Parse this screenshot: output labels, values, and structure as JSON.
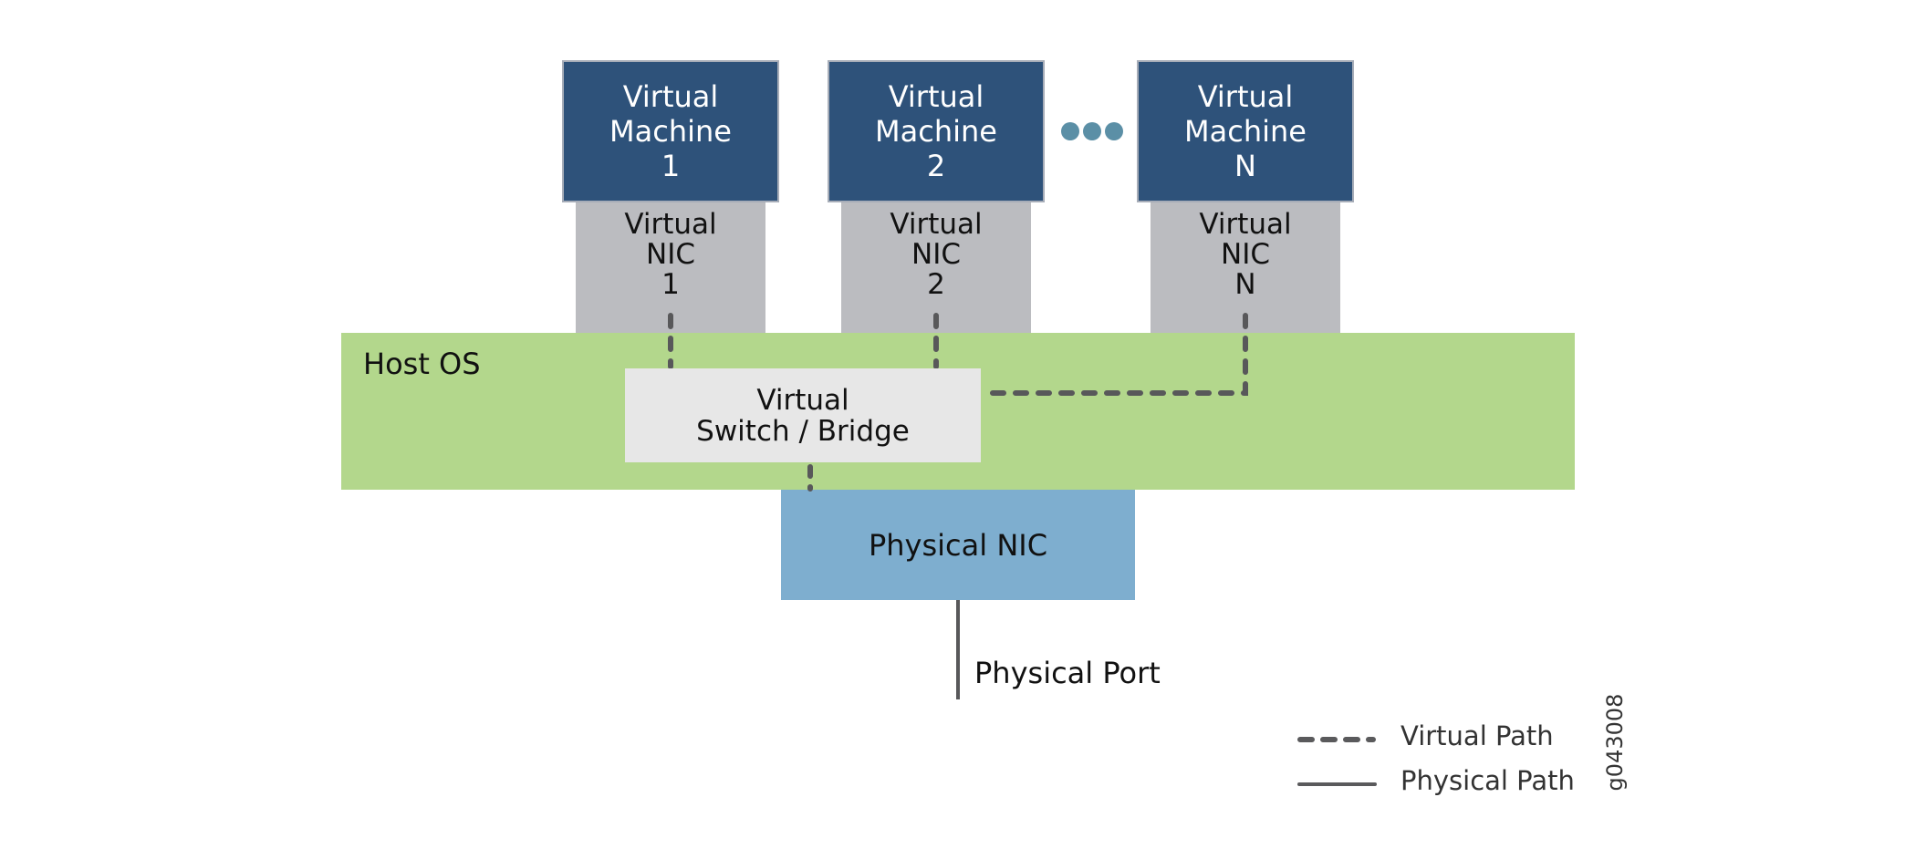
{
  "virtual_machines": [
    {
      "line1": "Virtual",
      "line2": "Machine",
      "line3": "1"
    },
    {
      "line1": "Virtual",
      "line2": "Machine",
      "line3": "2"
    },
    {
      "line1": "Virtual",
      "line2": "Machine",
      "line3": "N"
    }
  ],
  "virtual_nics": [
    {
      "line1": "Virtual",
      "line2": "NIC",
      "line3": "1"
    },
    {
      "line1": "Virtual",
      "line2": "NIC",
      "line3": "2"
    },
    {
      "line1": "Virtual",
      "line2": "NIC",
      "line3": "N"
    }
  ],
  "host_os": {
    "label": "Host OS"
  },
  "virtual_switch": {
    "line1": "Virtual",
    "line2": "Switch / Bridge"
  },
  "physical_nic": {
    "label": "Physical NIC"
  },
  "physical_port": {
    "label": "Physical Port"
  },
  "legend": {
    "virtual_path": "Virtual Path",
    "physical_path": "Physical Path"
  },
  "figure_id": "g043008",
  "colors": {
    "vm": "#2e527a",
    "nic": "#bbbcc0",
    "host_os": "#b3d78c",
    "switch": "#e7e7e7",
    "physical_nic": "#7eaecf",
    "ellipsis_dots": "#5b8fa6",
    "path_lines": "#58585a"
  }
}
